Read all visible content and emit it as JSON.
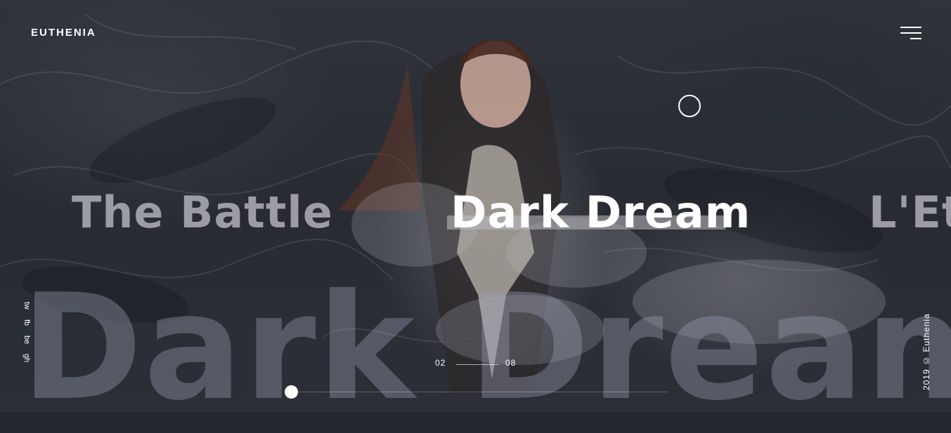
{
  "brand": {
    "logo_text": "EUTHENIA"
  },
  "menu": {
    "icon": "hamburger-menu-icon"
  },
  "slides": {
    "prev_title": "The Battle",
    "active_title": "Dark Dream",
    "next_title": "L'Et",
    "background_title": "Dark Dream"
  },
  "social": {
    "items": [
      {
        "label": "tw"
      },
      {
        "label": "fb"
      },
      {
        "label": "be"
      },
      {
        "label": "gh"
      }
    ]
  },
  "copyright": {
    "text": "2019 © Euthenia"
  },
  "counter": {
    "current": "02",
    "total": "08"
  },
  "progress": {
    "fraction": 0.0
  },
  "colors": {
    "text": "#ffffff",
    "background": "#2a2d34"
  }
}
